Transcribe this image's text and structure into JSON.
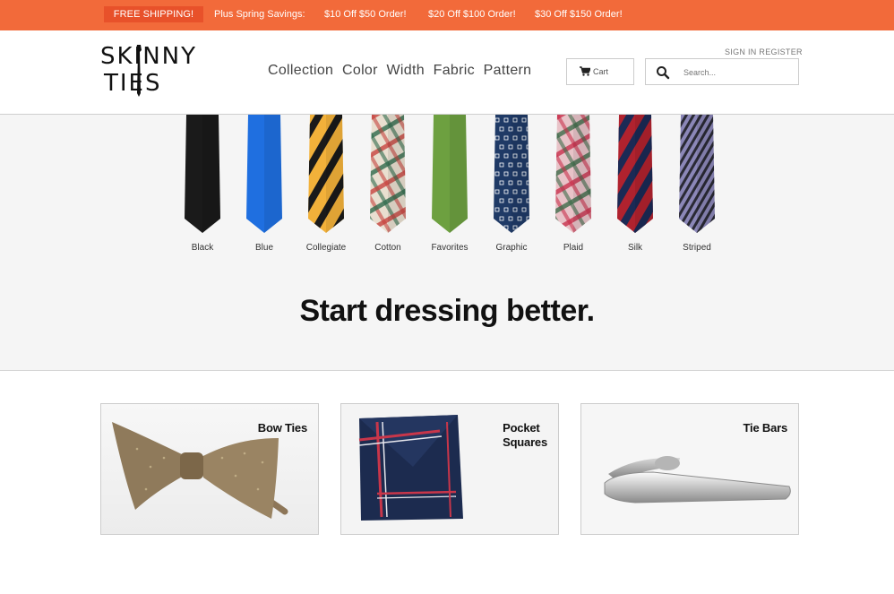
{
  "promo": {
    "free_shipping": "FREE SHIPPING!",
    "savings_label": "Plus Spring Savings:",
    "offers": [
      "$10 Off $50 Order!",
      "$20 Off $100 Order!",
      "$30 Off $150 Order!"
    ]
  },
  "header": {
    "logo_line1": "SKINNY",
    "logo_line2": "TIES",
    "nav": [
      "Collection",
      "Color",
      "Width",
      "Fabric",
      "Pattern"
    ],
    "sign_in": "SIGN IN",
    "register": "REGISTER",
    "cart_label": "Cart",
    "search_placeholder": "Search..."
  },
  "hero": {
    "ties": [
      {
        "label": "Black",
        "color": "#1a1a1a"
      },
      {
        "label": "Blue",
        "color": "#1f6fe0"
      },
      {
        "label": "Collegiate",
        "color": "#f2b13a"
      },
      {
        "label": "Cotton",
        "color": "#e9dfd0"
      },
      {
        "label": "Favorites",
        "color": "#6da040"
      },
      {
        "label": "Graphic",
        "color": "#1f3a66"
      },
      {
        "label": "Plaid",
        "color": "#e8c3c8"
      },
      {
        "label": "Silk",
        "color": "#b0222e"
      },
      {
        "label": "Striped",
        "color": "#8b87b8"
      }
    ],
    "headline": "Start dressing better."
  },
  "categories": [
    {
      "title_line1": "Bow Ties",
      "title_line2": ""
    },
    {
      "title_line1": "Pocket",
      "title_line2": "Squares"
    },
    {
      "title_line1": "Tie Bars",
      "title_line2": ""
    }
  ],
  "colors": {
    "promo_bar": "#f26a3a",
    "promo_badge": "#e8512a",
    "hero_bg": "#f5f5f5"
  },
  "icons": [
    "cart-icon",
    "search-icon"
  ]
}
